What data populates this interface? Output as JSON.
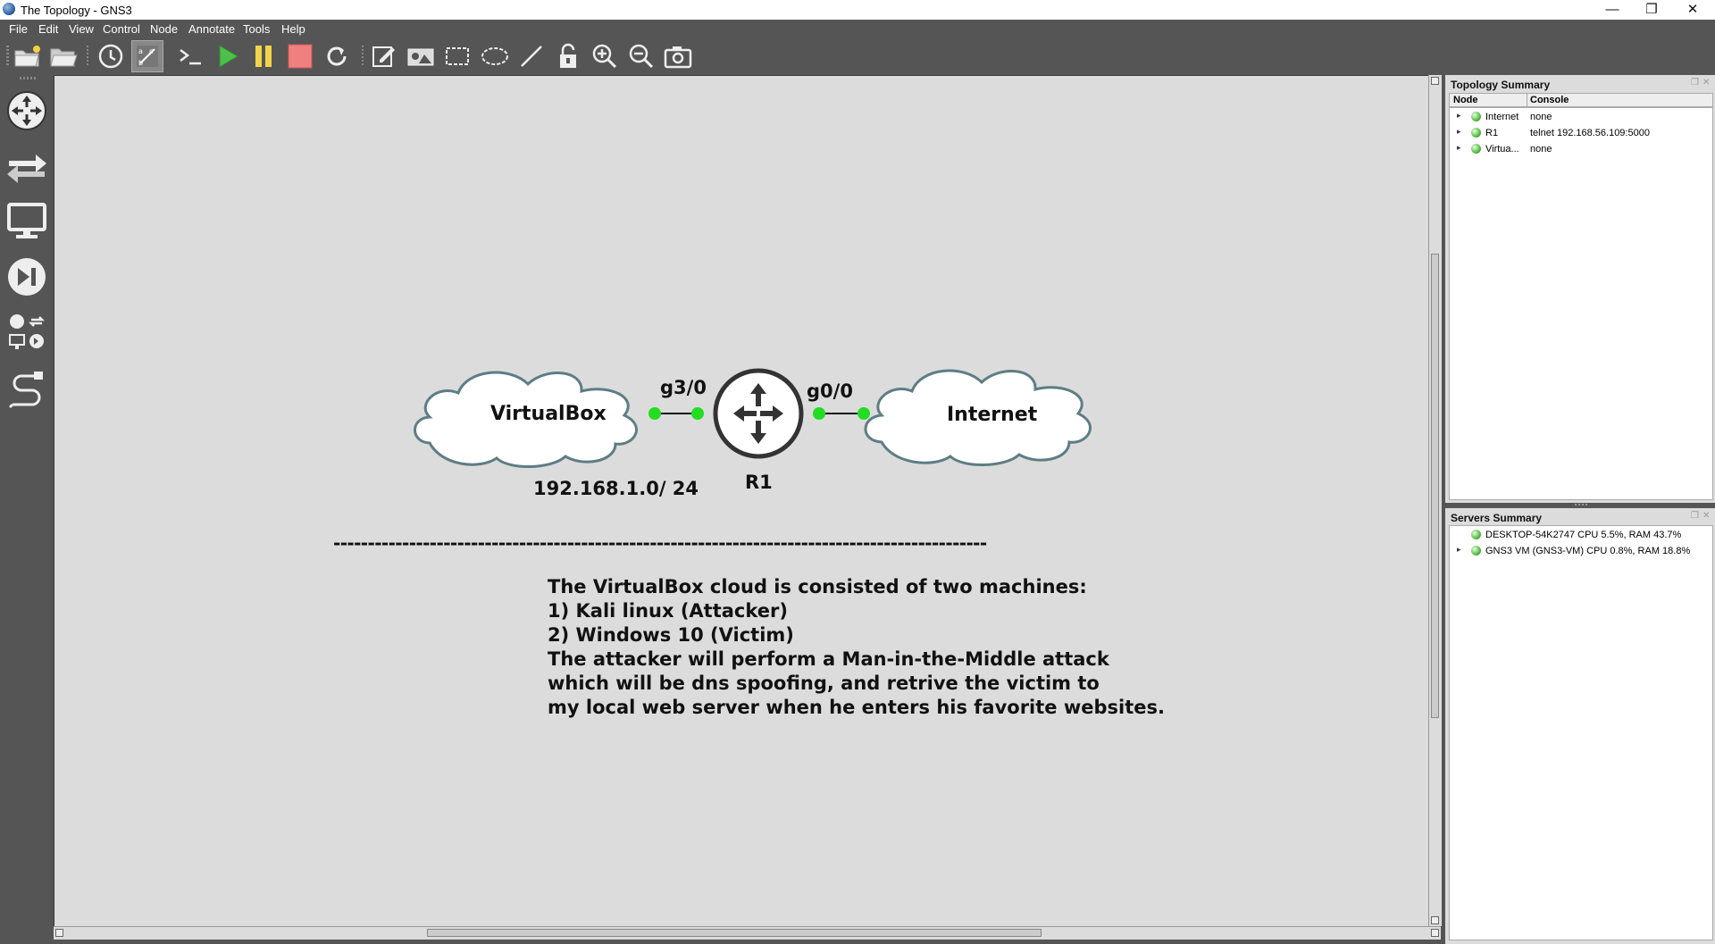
{
  "window": {
    "title": "The Topology - GNS3",
    "controls": {
      "minimize": "—",
      "restore": "❐",
      "close": "✕"
    }
  },
  "menu": [
    "File",
    "Edit",
    "View",
    "Control",
    "Node",
    "Annotate",
    "Tools",
    "Help"
  ],
  "toolbar_icons": [
    "new-project-icon",
    "open-project-icon",
    "snapshot-icon",
    "show-interface-labels-icon",
    "console-all-icon",
    "start-all-icon",
    "suspend-all-icon",
    "stop-all-icon",
    "reload-all-icon",
    "add-note-icon",
    "insert-picture-icon",
    "draw-rectangle-icon",
    "draw-ellipse-icon",
    "draw-line-icon",
    "lock-items-icon",
    "zoom-in-icon",
    "zoom-out-icon",
    "screenshot-icon"
  ],
  "device_panel_icons": [
    "routers-icon",
    "switches-icon",
    "end-devices-icon",
    "security-devices-icon",
    "all-devices-icon",
    "add-link-icon"
  ],
  "topology": {
    "nodes": {
      "virtualbox": {
        "label": "VirtualBox"
      },
      "r1": {
        "label": "R1"
      },
      "internet": {
        "label": "Internet"
      }
    },
    "interfaces": {
      "left": "g3/0",
      "right": "g0/0"
    },
    "subnet_label": "192.168.1.0/ 24",
    "separator": "-----------------------------------------------------------------------------------------------",
    "note_lines": [
      "The VirtualBox cloud is consisted of two machines:",
      "1) Kali linux (Attacker)",
      "2) Windows 10 (Victim)",
      "The attacker will perform a Man-in-the-Middle attack",
      "which will be dns spoofing, and retrive the victim to",
      "my local web server when he enters his favorite websites."
    ]
  },
  "topology_summary": {
    "title": "Topology Summary",
    "columns": [
      "Node",
      "Console"
    ],
    "rows": [
      {
        "node": "Internet",
        "console": "none"
      },
      {
        "node": "R1",
        "console": "telnet 192.168.56.109:5000"
      },
      {
        "node": "Virtua...",
        "console": "none"
      }
    ]
  },
  "servers_summary": {
    "title": "Servers Summary",
    "rows": [
      {
        "text": "DESKTOP-54K2747 CPU 5.5%, RAM 43.7%",
        "expandable": false
      },
      {
        "text": "GNS3 VM (GNS3-VM) CPU 0.8%, RAM 18.8%",
        "expandable": true
      }
    ]
  },
  "colors": {
    "canvas": "#dcdcdc",
    "chrome": "#555555",
    "link_dot": "#22dd22",
    "cloud_stroke": "#5e7d84"
  }
}
